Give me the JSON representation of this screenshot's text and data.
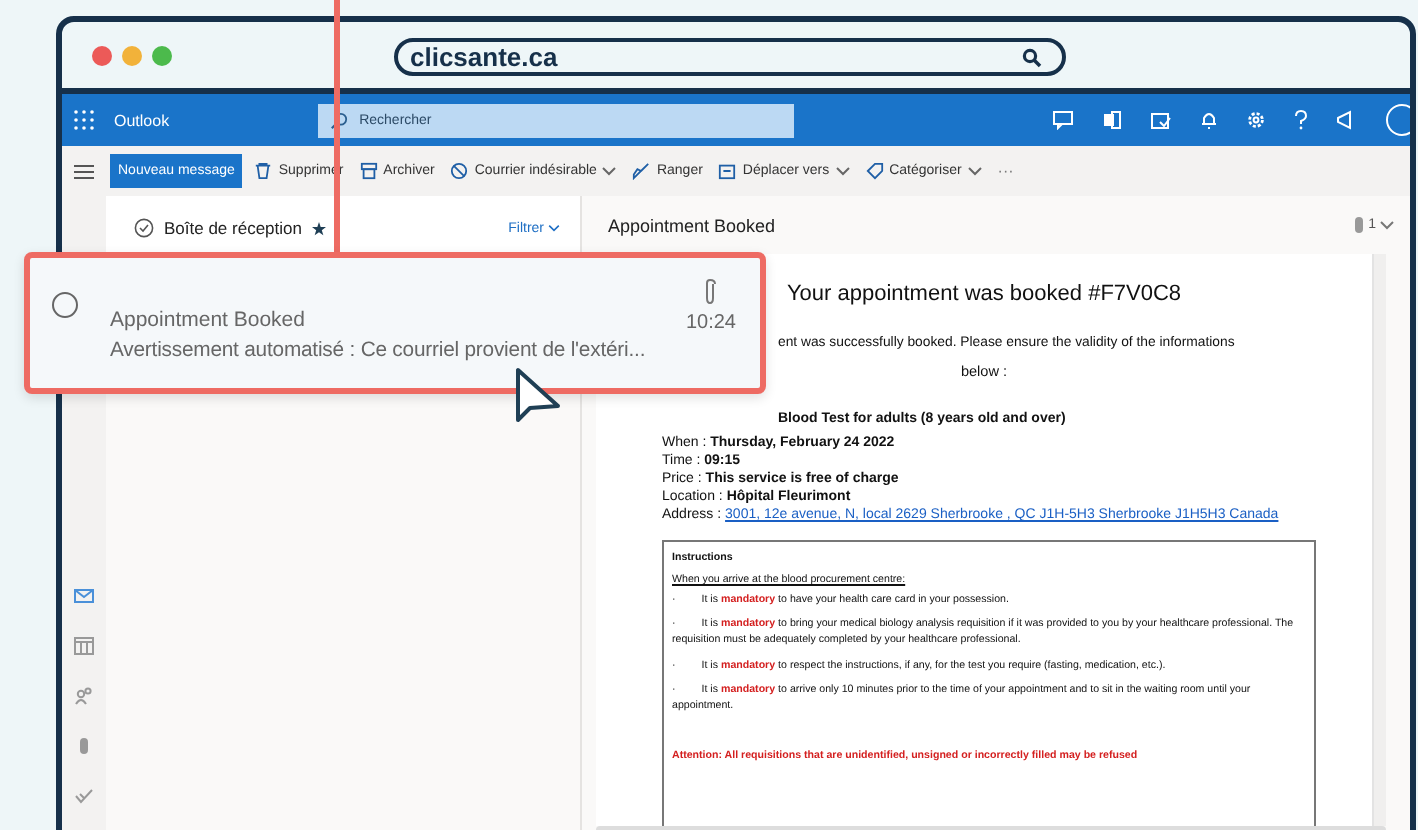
{
  "browser": {
    "url": "clicsante.ca"
  },
  "outlook": {
    "app_name": "Outlook",
    "search": {
      "placeholder": "Rechercher"
    }
  },
  "toolbar": {
    "new_message": "Nouveau message",
    "actions": [
      {
        "kind": "delete",
        "label": "Supprimer",
        "dropdown": false
      },
      {
        "kind": "archive",
        "label": "Archiver",
        "dropdown": false
      },
      {
        "kind": "junk",
        "label": "Courrier indésirable",
        "dropdown": true
      },
      {
        "kind": "sweep",
        "label": "Ranger",
        "dropdown": false
      },
      {
        "kind": "move",
        "label": "Déplacer vers",
        "dropdown": true
      },
      {
        "kind": "tag",
        "label": "Catégoriser",
        "dropdown": true
      }
    ],
    "more": "···"
  },
  "rail": [
    {
      "kind": "mail",
      "selected": true
    },
    {
      "kind": "calendar",
      "selected": false
    },
    {
      "kind": "people",
      "selected": false
    },
    {
      "kind": "clip",
      "selected": false
    },
    {
      "kind": "todo",
      "selected": false
    }
  ],
  "folder": {
    "title": "Boîte de réception",
    "favorite": true,
    "filter": "Filtrer"
  },
  "message": {
    "subject": "Appointment Booked",
    "preview": "Avertissement automatisé : Ce courriel provient de l'extéri...",
    "time": "10:24",
    "has_attachment": true
  },
  "reading": {
    "subject": "Appointment Booked",
    "attachment_count": "1",
    "email": {
      "heading": "Your appointment was booked #F7V0C8",
      "intro": "ent was successfully booked. Please ensure the validity of the informations",
      "intro_end": "below :",
      "service": "Blood Test for adults (8 years old and over)",
      "details": [
        "When : **Thursday, February 24 2022**",
        "Time : **09:15**",
        "Price : **This service is free of charge**",
        "Location : **Hôpital Fleurimont**"
      ],
      "address": {
        "label": "Address :",
        "link": "3001, 12e avenue, N, local 2629 Sherbrooke , QC J1H-5H3 Sherbrooke J1H5H3 Canada"
      },
      "instructions": {
        "title": "Instructions",
        "subtitle": "When you arrive at the blood procurement centre:",
        "items": [
          {
            "bullet": "·",
            "text": "It is **mandatory** to have your health care card in your possession."
          },
          {
            "bullet": "·",
            "text": "It is **mandatory** to bring your medical biology analysis requisition if it was provided to you by your healthcare professional. The requisition must be adequately completed by your healthcare professional."
          },
          {
            "bullet": "·",
            "text": "It is **mandatory** to respect the instructions, if any, for the test you require (fasting, medication, etc.)."
          },
          {
            "bullet": "·",
            "text": "It is **mandatory** to arrive only 10 minutes prior to the time of your appointment and to sit in the waiting room until your appointment."
          }
        ],
        "warning": "Attention: All requisitions that are unidentified, unsigned or incorrectly filled may be refused"
      }
    }
  }
}
